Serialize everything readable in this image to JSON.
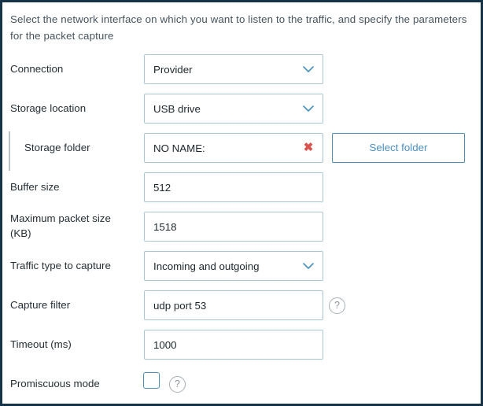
{
  "panel": {
    "intro_text": "Select the network interface on which you want to listen to the traffic, and specify the parameters for the packet  capture"
  },
  "form": {
    "rows": [
      {
        "label": "Connection",
        "value": "Provider",
        "control": "select"
      },
      {
        "label": "Storage location",
        "value": "USB drive",
        "control": "select"
      },
      {
        "label": "Storage folder",
        "value": "NO NAME:",
        "control": "text-clearable",
        "button_label": "Select folder"
      },
      {
        "label": "Buffer size",
        "value": "512",
        "control": "text"
      },
      {
        "label": "Maximum packet size (KB)",
        "label_line1": "Maximum packet size",
        "label_line2": "(KB)",
        "value": "1518",
        "control": "text"
      },
      {
        "label": "Traffic type to capture",
        "value": "Incoming and outgoing",
        "control": "select"
      },
      {
        "label": "Capture filter",
        "value": "udp port 53",
        "control": "text-help",
        "help_glyph": "?"
      },
      {
        "label": "Timeout (ms)",
        "value": "1000",
        "control": "text"
      },
      {
        "label": "Promiscuous mode",
        "value": "",
        "control": "checkbox",
        "checked": false,
        "help_glyph": "?"
      }
    ],
    "clear_glyph": "✖"
  },
  "colors": {
    "frame": "#163347",
    "field_border": "#a9c6d6",
    "accent_blue": "#4a90c2",
    "clear_red": "#d9534f",
    "label_text": "#262f35",
    "intro_text": "#46535c"
  }
}
